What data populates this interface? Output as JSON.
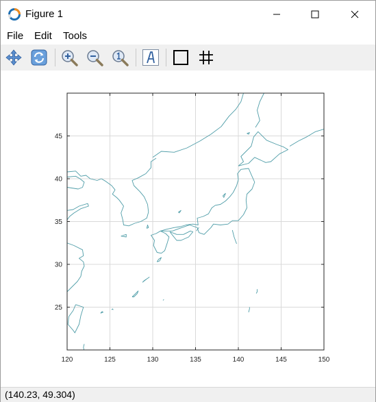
{
  "window": {
    "title": "Figure 1"
  },
  "menu": [
    {
      "label": "File"
    },
    {
      "label": "Edit"
    },
    {
      "label": "Tools"
    }
  ],
  "toolbar": {
    "buttons": [
      {
        "name": "pan-icon"
      },
      {
        "name": "rotate-icon"
      },
      {
        "name": "zoom-in-icon"
      },
      {
        "name": "zoom-out-icon"
      },
      {
        "name": "zoom-reset-icon"
      },
      {
        "name": "insert-text-icon"
      },
      {
        "name": "box-icon"
      },
      {
        "name": "grid-icon"
      }
    ]
  },
  "status": {
    "coords": "(140.23, 49.304)"
  },
  "colors": {
    "coastline": "#4f9da8",
    "grid": "#d9d9d9",
    "axes": "#262626"
  },
  "chart_data": {
    "type": "line",
    "title": "",
    "xlabel": "",
    "ylabel": "",
    "xlim": [
      120,
      150
    ],
    "ylim": [
      20,
      50
    ],
    "xticks": [
      120,
      125,
      130,
      135,
      140,
      145,
      150
    ],
    "yticks": [
      25,
      30,
      35,
      40,
      45
    ],
    "grid": true,
    "series": [
      {
        "values": [
          [
            130.0,
            42.5
          ],
          [
            131.0,
            43.2
          ],
          [
            132.5,
            43.1
          ],
          [
            134.0,
            43.6
          ],
          [
            135.5,
            44.4
          ],
          [
            136.8,
            45.2
          ],
          [
            138.0,
            46.1
          ],
          [
            138.9,
            47.3
          ],
          [
            139.7,
            48.1
          ],
          [
            140.3,
            49.0
          ],
          [
            140.6,
            50.0
          ]
        ]
      },
      {
        "values": [
          [
            124.0,
            40.0
          ],
          [
            124.5,
            39.7
          ],
          [
            125.2,
            39.2
          ],
          [
            125.6,
            38.7
          ],
          [
            125.3,
            38.2
          ],
          [
            125.8,
            37.8
          ],
          [
            126.1,
            37.5
          ],
          [
            126.6,
            36.8
          ],
          [
            126.3,
            36.0
          ],
          [
            126.5,
            35.2
          ],
          [
            126.6,
            34.6
          ],
          [
            127.2,
            34.5
          ],
          [
            127.9,
            34.8
          ],
          [
            128.6,
            35.0
          ],
          [
            129.3,
            35.4
          ],
          [
            129.5,
            36.1
          ],
          [
            129.4,
            37.0
          ],
          [
            129.0,
            37.9
          ],
          [
            128.5,
            38.5
          ],
          [
            127.8,
            39.2
          ],
          [
            127.6,
            39.8
          ],
          [
            128.3,
            40.1
          ],
          [
            129.2,
            40.6
          ],
          [
            129.8,
            41.3
          ],
          [
            129.8,
            42.0
          ],
          [
            130.4,
            42.4
          ]
        ]
      },
      {
        "values": [
          [
            130.9,
            33.9
          ],
          [
            131.6,
            34.1
          ],
          [
            132.5,
            34.3
          ],
          [
            133.2,
            34.4
          ],
          [
            133.9,
            34.6
          ],
          [
            134.7,
            34.7
          ],
          [
            135.3,
            34.6
          ],
          [
            135.2,
            35.4
          ],
          [
            135.9,
            35.6
          ],
          [
            136.5,
            35.9
          ],
          [
            136.9,
            36.6
          ],
          [
            137.3,
            36.9
          ],
          [
            137.9,
            37.0
          ],
          [
            138.5,
            37.4
          ],
          [
            139.0,
            37.9
          ],
          [
            139.4,
            38.4
          ],
          [
            139.8,
            39.2
          ],
          [
            140.0,
            39.9
          ],
          [
            139.9,
            40.6
          ],
          [
            140.3,
            41.1
          ],
          [
            141.2,
            41.2
          ],
          [
            141.5,
            40.5
          ],
          [
            141.9,
            39.6
          ],
          [
            141.6,
            38.8
          ],
          [
            141.0,
            38.2
          ],
          [
            140.9,
            37.5
          ],
          [
            141.0,
            36.6
          ],
          [
            140.6,
            35.8
          ],
          [
            140.0,
            35.1
          ],
          [
            139.3,
            35.1
          ],
          [
            138.8,
            34.7
          ],
          [
            137.9,
            34.6
          ],
          [
            137.1,
            34.7
          ],
          [
            136.8,
            34.3
          ],
          [
            136.0,
            33.5
          ],
          [
            135.4,
            33.7
          ],
          [
            135.2,
            34.3
          ],
          [
            134.3,
            34.6
          ],
          [
            133.4,
            34.3
          ],
          [
            132.3,
            33.9
          ],
          [
            131.4,
            33.9
          ],
          [
            130.9,
            33.9
          ]
        ]
      },
      {
        "values": [
          [
            132.0,
            33.8
          ],
          [
            132.8,
            33.5
          ],
          [
            133.6,
            33.5
          ],
          [
            134.4,
            33.9
          ],
          [
            134.7,
            33.8
          ],
          [
            134.2,
            33.2
          ],
          [
            133.3,
            32.8
          ],
          [
            132.8,
            32.8
          ],
          [
            132.4,
            33.3
          ],
          [
            132.0,
            33.8
          ]
        ]
      },
      {
        "values": [
          [
            130.9,
            33.9
          ],
          [
            130.4,
            33.6
          ],
          [
            129.8,
            33.4
          ],
          [
            130.2,
            32.8
          ],
          [
            130.1,
            32.2
          ],
          [
            130.5,
            31.4
          ],
          [
            131.0,
            31.3
          ],
          [
            131.4,
            31.6
          ],
          [
            131.7,
            32.5
          ],
          [
            131.9,
            33.2
          ],
          [
            131.5,
            33.6
          ],
          [
            130.9,
            33.9
          ]
        ]
      },
      {
        "values": [
          [
            140.0,
            41.5
          ],
          [
            140.6,
            42.0
          ],
          [
            140.3,
            42.6
          ],
          [
            140.9,
            43.2
          ],
          [
            141.5,
            43.8
          ],
          [
            141.8,
            44.9
          ],
          [
            142.3,
            45.5
          ],
          [
            143.3,
            44.5
          ],
          [
            144.5,
            44.0
          ],
          [
            145.3,
            43.7
          ],
          [
            145.8,
            43.4
          ],
          [
            144.8,
            42.9
          ],
          [
            143.8,
            42.0
          ],
          [
            143.2,
            41.9
          ],
          [
            141.9,
            42.5
          ],
          [
            141.2,
            41.8
          ],
          [
            140.0,
            41.5
          ]
        ]
      },
      {
        "values": [
          [
            142.0,
            46.0
          ],
          [
            142.5,
            46.8
          ],
          [
            142.2,
            48.0
          ],
          [
            142.5,
            49.0
          ],
          [
            143.0,
            50.0
          ]
        ]
      },
      {
        "values": [
          [
            146.0,
            43.8
          ],
          [
            147.0,
            44.4
          ],
          [
            148.0,
            44.9
          ],
          [
            149.0,
            45.5
          ],
          [
            150.0,
            45.8
          ]
        ]
      },
      {
        "values": [
          [
            120.0,
            40.8
          ],
          [
            121.0,
            40.9
          ],
          [
            121.6,
            40.3
          ],
          [
            122.2,
            40.4
          ],
          [
            122.7,
            40.0
          ],
          [
            123.5,
            39.8
          ],
          [
            124.0,
            40.0
          ]
        ]
      },
      {
        "values": [
          [
            120.0,
            39.0
          ],
          [
            121.3,
            38.8
          ],
          [
            121.8,
            39.0
          ],
          [
            122.0,
            39.6
          ],
          [
            121.5,
            40.0
          ],
          [
            121.0,
            40.3
          ],
          [
            120.0,
            40.2
          ]
        ]
      },
      {
        "values": [
          [
            120.0,
            36.3
          ],
          [
            120.7,
            36.4
          ],
          [
            121.4,
            36.8
          ],
          [
            122.4,
            37.1
          ],
          [
            122.5,
            36.8
          ],
          [
            121.6,
            36.5
          ],
          [
            120.8,
            36.0
          ],
          [
            120.3,
            35.6
          ],
          [
            120.0,
            35.2
          ]
        ]
      },
      {
        "values": [
          [
            120.0,
            32.5
          ],
          [
            120.8,
            32.2
          ],
          [
            121.8,
            31.7
          ],
          [
            121.9,
            31.0
          ],
          [
            121.4,
            30.7
          ],
          [
            121.9,
            30.3
          ],
          [
            122.0,
            29.8
          ],
          [
            121.7,
            29.2
          ],
          [
            121.6,
            28.6
          ],
          [
            121.2,
            28.0
          ],
          [
            120.8,
            27.6
          ],
          [
            120.4,
            27.2
          ],
          [
            120.0,
            26.8
          ]
        ]
      },
      {
        "values": [
          [
            121.0,
            25.3
          ],
          [
            121.9,
            25.0
          ],
          [
            121.6,
            24.0
          ],
          [
            121.4,
            23.0
          ],
          [
            120.9,
            22.0
          ],
          [
            120.7,
            22.3
          ],
          [
            120.1,
            23.0
          ],
          [
            120.2,
            23.9
          ],
          [
            120.7,
            24.6
          ],
          [
            121.0,
            25.3
          ]
        ]
      },
      {
        "values": [
          [
            127.6,
            26.2
          ],
          [
            127.9,
            26.5
          ],
          [
            128.3,
            26.9
          ],
          [
            128.2,
            26.6
          ],
          [
            127.8,
            26.2
          ],
          [
            127.6,
            26.2
          ]
        ]
      },
      {
        "values": [
          [
            128.8,
            27.9
          ],
          [
            129.3,
            28.3
          ],
          [
            129.6,
            28.5
          ],
          [
            129.0,
            28.1
          ],
          [
            128.8,
            27.9
          ]
        ]
      },
      {
        "values": [
          [
            130.5,
            30.3
          ],
          [
            130.7,
            30.6
          ],
          [
            131.0,
            30.8
          ],
          [
            130.8,
            30.4
          ],
          [
            130.5,
            30.3
          ]
        ]
      },
      {
        "values": [
          [
            129.3,
            34.2
          ],
          [
            129.4,
            34.6
          ],
          [
            129.5,
            34.3
          ],
          [
            129.3,
            34.2
          ]
        ]
      },
      {
        "values": [
          [
            126.3,
            33.3
          ],
          [
            126.9,
            33.5
          ],
          [
            126.9,
            33.2
          ],
          [
            126.3,
            33.3
          ]
        ]
      },
      {
        "values": [
          [
            133.1,
            36.0
          ],
          [
            133.3,
            36.3
          ],
          [
            133.0,
            36.1
          ],
          [
            133.1,
            36.0
          ]
        ]
      },
      {
        "values": [
          [
            138.3,
            37.8
          ],
          [
            138.5,
            38.3
          ],
          [
            138.2,
            38.0
          ],
          [
            138.3,
            37.8
          ]
        ]
      },
      {
        "values": [
          [
            139.3,
            34.0
          ],
          [
            139.5,
            33.2
          ],
          [
            139.8,
            32.4
          ]
        ]
      },
      {
        "values": [
          [
            142.2,
            27.1
          ],
          [
            142.2,
            26.8
          ],
          [
            142.1,
            26.6
          ]
        ]
      },
      {
        "values": [
          [
            141.3,
            25.0
          ],
          [
            141.3,
            24.8
          ],
          [
            141.2,
            24.4
          ]
        ]
      },
      {
        "values": [
          [
            123.9,
            24.3
          ],
          [
            124.2,
            24.4
          ],
          [
            124.1,
            24.5
          ],
          [
            123.9,
            24.3
          ]
        ]
      },
      {
        "values": [
          [
            125.2,
            24.7
          ],
          [
            125.3,
            24.8
          ],
          [
            125.4,
            24.7
          ]
        ]
      },
      {
        "values": [
          [
            122.0,
            20.7
          ],
          [
            121.9,
            20.3
          ],
          [
            122.0,
            19.9
          ]
        ]
      },
      {
        "values": [
          [
            135.4,
            34.3
          ],
          [
            135.3,
            34.2
          ],
          [
            135.1,
            33.9
          ]
        ]
      },
      {
        "values": [
          [
            131.2,
            25.8
          ],
          [
            131.3,
            25.9
          ]
        ]
      },
      {
        "values": [
          [
            141.0,
            45.3
          ],
          [
            141.2,
            45.2
          ],
          [
            141.3,
            45.4
          ],
          [
            141.0,
            45.3
          ]
        ]
      }
    ]
  }
}
